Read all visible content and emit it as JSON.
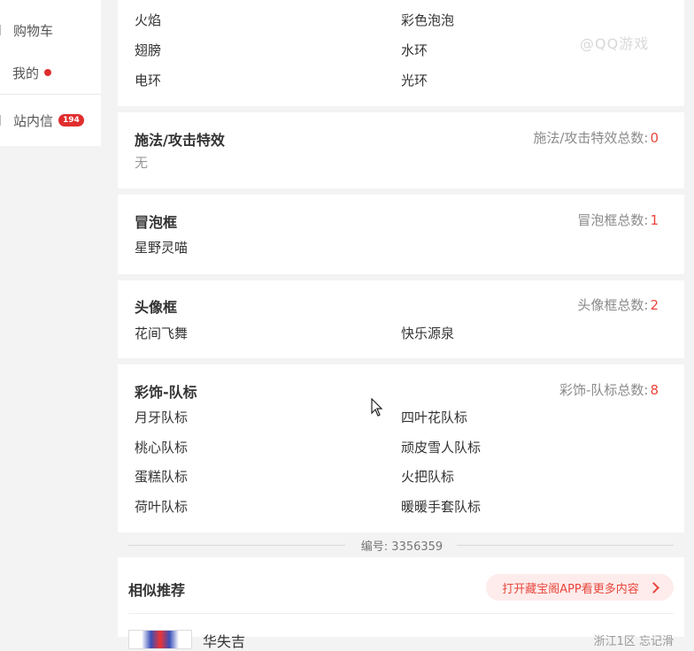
{
  "sidebar": {
    "items": [
      {
        "label": "购物车"
      },
      {
        "label": "我的"
      },
      {
        "label": "站内信",
        "badge": "194"
      }
    ]
  },
  "top_card": {
    "items": [
      "火焰",
      "彩色泡泡",
      "翅膀",
      "水环",
      "电环",
      "光环"
    ]
  },
  "sections": [
    {
      "title": "施法/攻击特效",
      "count_label": "施法/攻击特效总数:",
      "count": "0",
      "items": [],
      "empty_text": "无"
    },
    {
      "title": "冒泡框",
      "count_label": "冒泡框总数:",
      "count": "1",
      "items": [
        "星野灵喵"
      ]
    },
    {
      "title": "头像框",
      "count_label": "头像框总数:",
      "count": "2",
      "items": [
        "花间飞舞",
        "快乐源泉"
      ]
    },
    {
      "title": "彩饰-队标",
      "count_label": "彩饰-队标总数:",
      "count": "8",
      "items": [
        "月牙队标",
        "四叶花队标",
        "桃心队标",
        "顽皮雪人队标",
        "蛋糕队标",
        "火把队标",
        "荷叶队标",
        "暖暖手套队标"
      ]
    }
  ],
  "serial": "编号: 3356359",
  "recommend": {
    "title": "相似推荐",
    "button": "打开藏宝阁APP看更多内容",
    "first_item_name": "华失吉",
    "first_item_meta": "浙江1区 忘记滑"
  },
  "watermark": "@QQ游戏",
  "colors": {
    "accent": "#e8453c",
    "badge": "#e02e2e"
  }
}
